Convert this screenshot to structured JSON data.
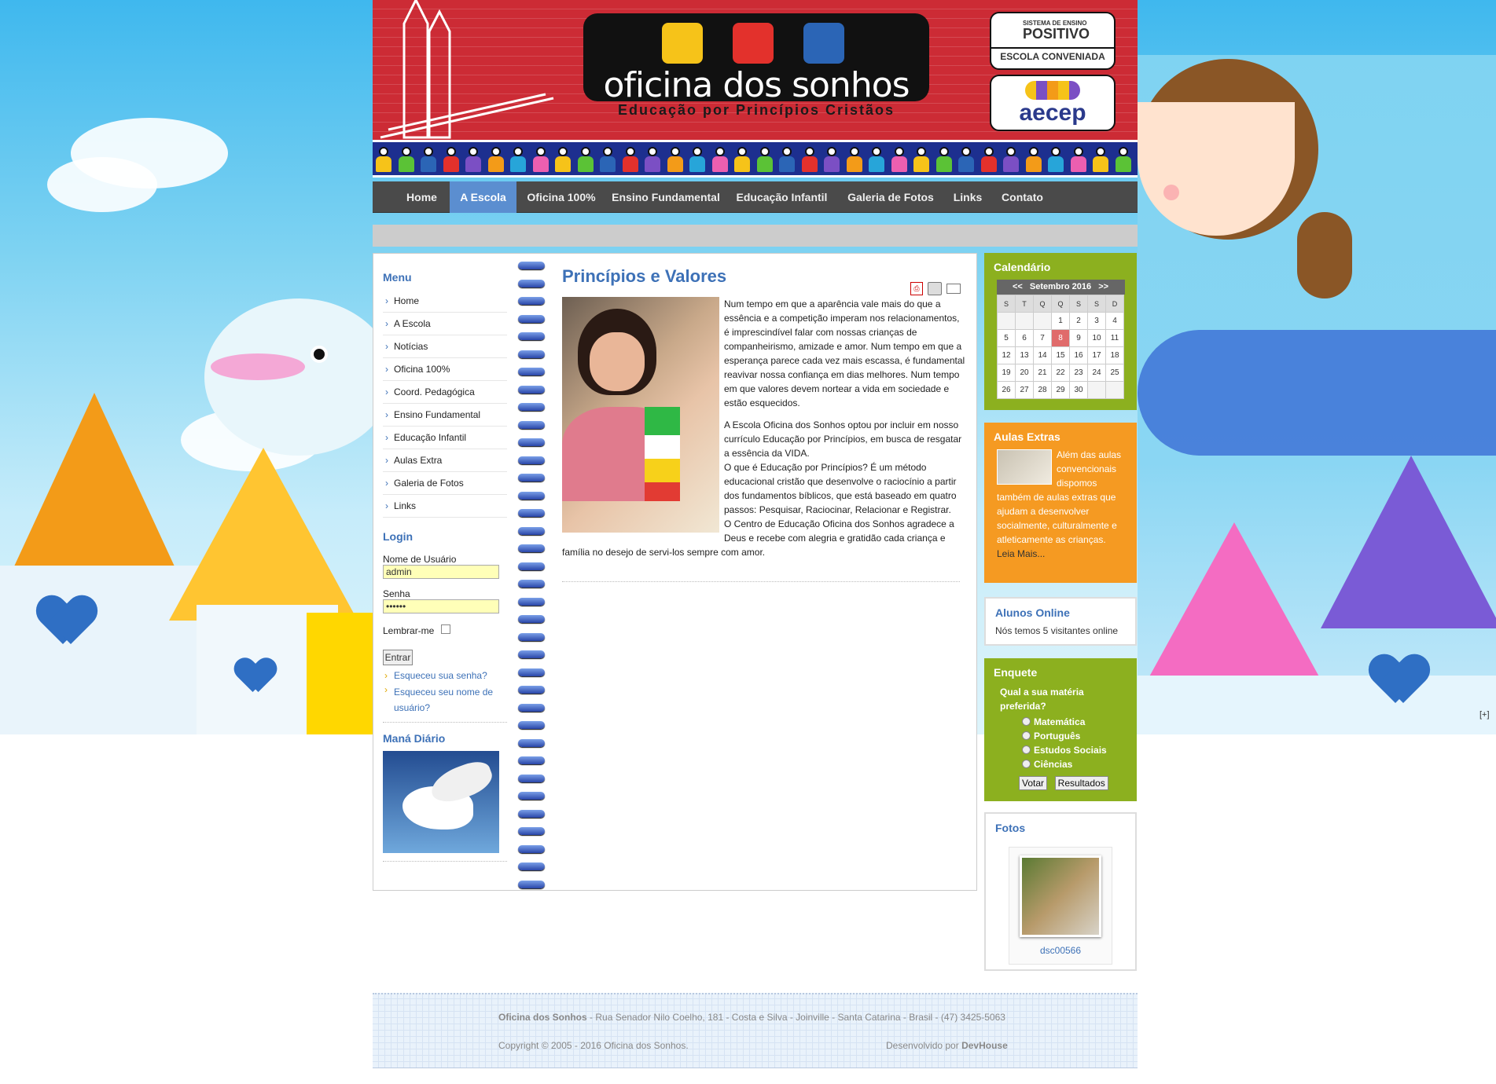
{
  "header": {
    "logo_title": "oficina dos sonhos",
    "logo_subtitle": "Educação por Princípios Cristãos",
    "badge1_top": "SISTEMA DE ENSINO",
    "badge1_name": "POSITIVO",
    "badge1_bottom": "ESCOLA CONVENIADA",
    "badge2_name": "aecep",
    "colors": {
      "header_red": "#cc2b35",
      "accent_blue": "#3d71b7"
    }
  },
  "nav": {
    "items": [
      {
        "label": "Home"
      },
      {
        "label": "A Escola"
      },
      {
        "label": "Oficina 100%"
      },
      {
        "label": "Ensino Fundamental"
      },
      {
        "label": "Educação Infantil"
      },
      {
        "label": "Galeria de Fotos"
      },
      {
        "label": "Links"
      },
      {
        "label": "Contato"
      }
    ],
    "active": "A Escola"
  },
  "left": {
    "menu_title": "Menu",
    "menu_items": [
      "Home",
      "A Escola",
      "Notícias",
      "Oficina 100%",
      "Coord. Pedagógica",
      "Ensino Fundamental",
      "Educação Infantil",
      "Aulas Extra",
      "Galeria de Fotos",
      "Links"
    ],
    "login_title": "Login",
    "username_label": "Nome de Usuário",
    "username_value": "admin",
    "password_label": "Senha",
    "password_value": "••••••",
    "remember_label": "Lembrar-me",
    "submit_label": "Entrar",
    "forgot_password": "Esqueceu sua senha?",
    "forgot_username": "Esqueceu seu nome de usuário?",
    "mana_title": "Maná Diário"
  },
  "article": {
    "title": "Princípios e Valores",
    "icons": [
      "pdf-icon",
      "print-icon",
      "email-icon"
    ],
    "p1": "Num tempo em que a aparência vale mais do que a essência e a competição imperam nos relacionamentos, é imprescindível falar com nossas crianças de companheirismo, amizade e amor. Num tempo em que a esperança parece cada vez mais escassa, é fundamental reavivar nossa confiança em dias melhores. Num tempo em que valores devem nortear a vida em sociedade e estão esquecidos.",
    "p2": "A Escola Oficina dos Sonhos optou por incluir em nosso currículo Educação por Princípios, em busca de resgatar a essência da VIDA.",
    "p3": "O que é Educação por Princípios? É um método educacional cristão que desenvolve o raciocínio a partir dos fundamentos bíblicos, que está baseado em quatro passos: Pesquisar, Raciocinar, Relacionar e Registrar.",
    "p4": "O Centro de Educação Oficina dos Sonhos agradece a Deus e recebe com alegria e gratidão cada criança e família no desejo de servi-los sempre com amor."
  },
  "right": {
    "calendar_title": "Calendário",
    "calendar_prev": "<<",
    "calendar_month": "Setembro 2016",
    "calendar_next": ">>",
    "weekdays": [
      "S",
      "T",
      "Q",
      "Q",
      "S",
      "S",
      "D"
    ],
    "weeks": [
      [
        "",
        "",
        "",
        "1",
        "2",
        "3",
        "4"
      ],
      [
        "5",
        "6",
        "7",
        "8",
        "9",
        "10",
        "11"
      ],
      [
        "12",
        "13",
        "14",
        "15",
        "16",
        "17",
        "18"
      ],
      [
        "19",
        "20",
        "21",
        "22",
        "23",
        "24",
        "25"
      ],
      [
        "26",
        "27",
        "28",
        "29",
        "30",
        "",
        ""
      ]
    ],
    "today": "8",
    "extras_title": "Aulas Extras",
    "extras_text": "Além das aulas convencionais dispomos também de aulas extras que ajudam a desenvolver socialmente, culturalmente e atleticamente as crianças.",
    "extras_more": "Leia Mais...",
    "online_title": "Alunos Online",
    "online_text": "Nós temos 5 visitantes online",
    "poll_title": "Enquete",
    "poll_question": "Qual a sua matéria preferida?",
    "poll_options": [
      "Matemática",
      "Português",
      "Estudos Sociais",
      "Ciências"
    ],
    "poll_vote": "Votar",
    "poll_results": "Resultados",
    "photos_title": "Fotos",
    "photo_caption": "dsc00566"
  },
  "side_toggle": "[+]",
  "footer": {
    "school": "Oficina dos Sonhos",
    "address": " - Rua Senador Nilo Coelho, 181 - Costa e Silva - Joinville - Santa Catarina - Brasil - (47) 3425-5063",
    "copyright": "Copyright © 2005 - 2016 Oficina dos Sonhos.",
    "dev_prefix": "Desenvolvido por ",
    "dev_name": "DevHouse"
  }
}
